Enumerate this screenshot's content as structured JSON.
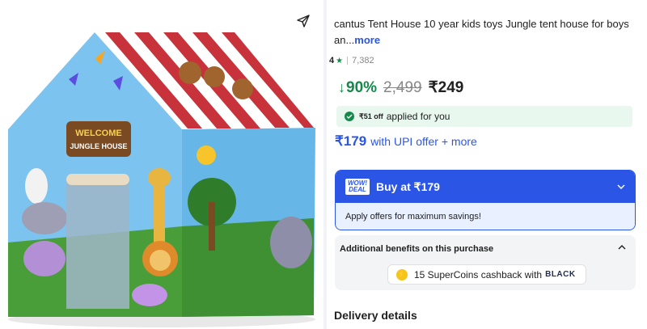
{
  "product": {
    "title": "cantus Tent House 10 year kids toys Jungle tent house for boys an...",
    "more_label": "more",
    "image_alt": "Jungle tent house product image",
    "image_sign_text": [
      "WELCOME",
      "JUNGLE HOUSE"
    ]
  },
  "rating": {
    "value": "4",
    "count": "7,382"
  },
  "pricing": {
    "discount": "90%",
    "mrp": "2,499",
    "price": "₹249",
    "offer_off": "₹51 off",
    "offer_applied_text": "applied for you",
    "upi_price": "₹179",
    "upi_text": "with UPI offer + more"
  },
  "buy": {
    "badge_line1": "WOW!",
    "badge_line2": "DEAL",
    "label": "Buy at ₹179",
    "sub_text": "Apply offers for maximum savings!"
  },
  "benefits": {
    "heading": "Additional benefits on this purchase",
    "coins_text": "15 SuperCoins cashback with",
    "black_label": "BLACK"
  },
  "delivery": {
    "heading": "Delivery details"
  },
  "colors": {
    "accent_blue": "#2a55e5",
    "discount_green": "#138a4a",
    "offer_bg": "#e8f8ee"
  },
  "icons": {
    "share": "share-icon",
    "star": "star-icon",
    "chevron_down": "chevron-down-icon",
    "chevron_up": "chevron-up-icon",
    "coin": "supercoin-icon"
  }
}
